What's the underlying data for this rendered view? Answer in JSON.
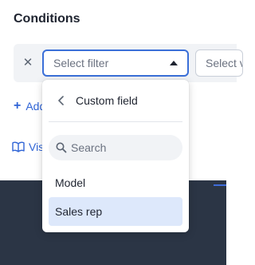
{
  "section": {
    "title": "Conditions"
  },
  "filter_row": {
    "remove_icon": "close-icon",
    "select_placeholder": "Select filter",
    "second_select_placeholder": "Select value",
    "accent_color": "#3a6fd8"
  },
  "links": {
    "add_label": "Add",
    "visibility_label": "Visibility"
  },
  "dropdown": {
    "back_icon": "chevron-left-icon",
    "title": "Custom field",
    "search_placeholder": "Search",
    "items": [
      {
        "label": "Model",
        "selected": false
      },
      {
        "label": "Sales rep",
        "selected": true
      }
    ],
    "selected_bg": "#dde8fb"
  }
}
